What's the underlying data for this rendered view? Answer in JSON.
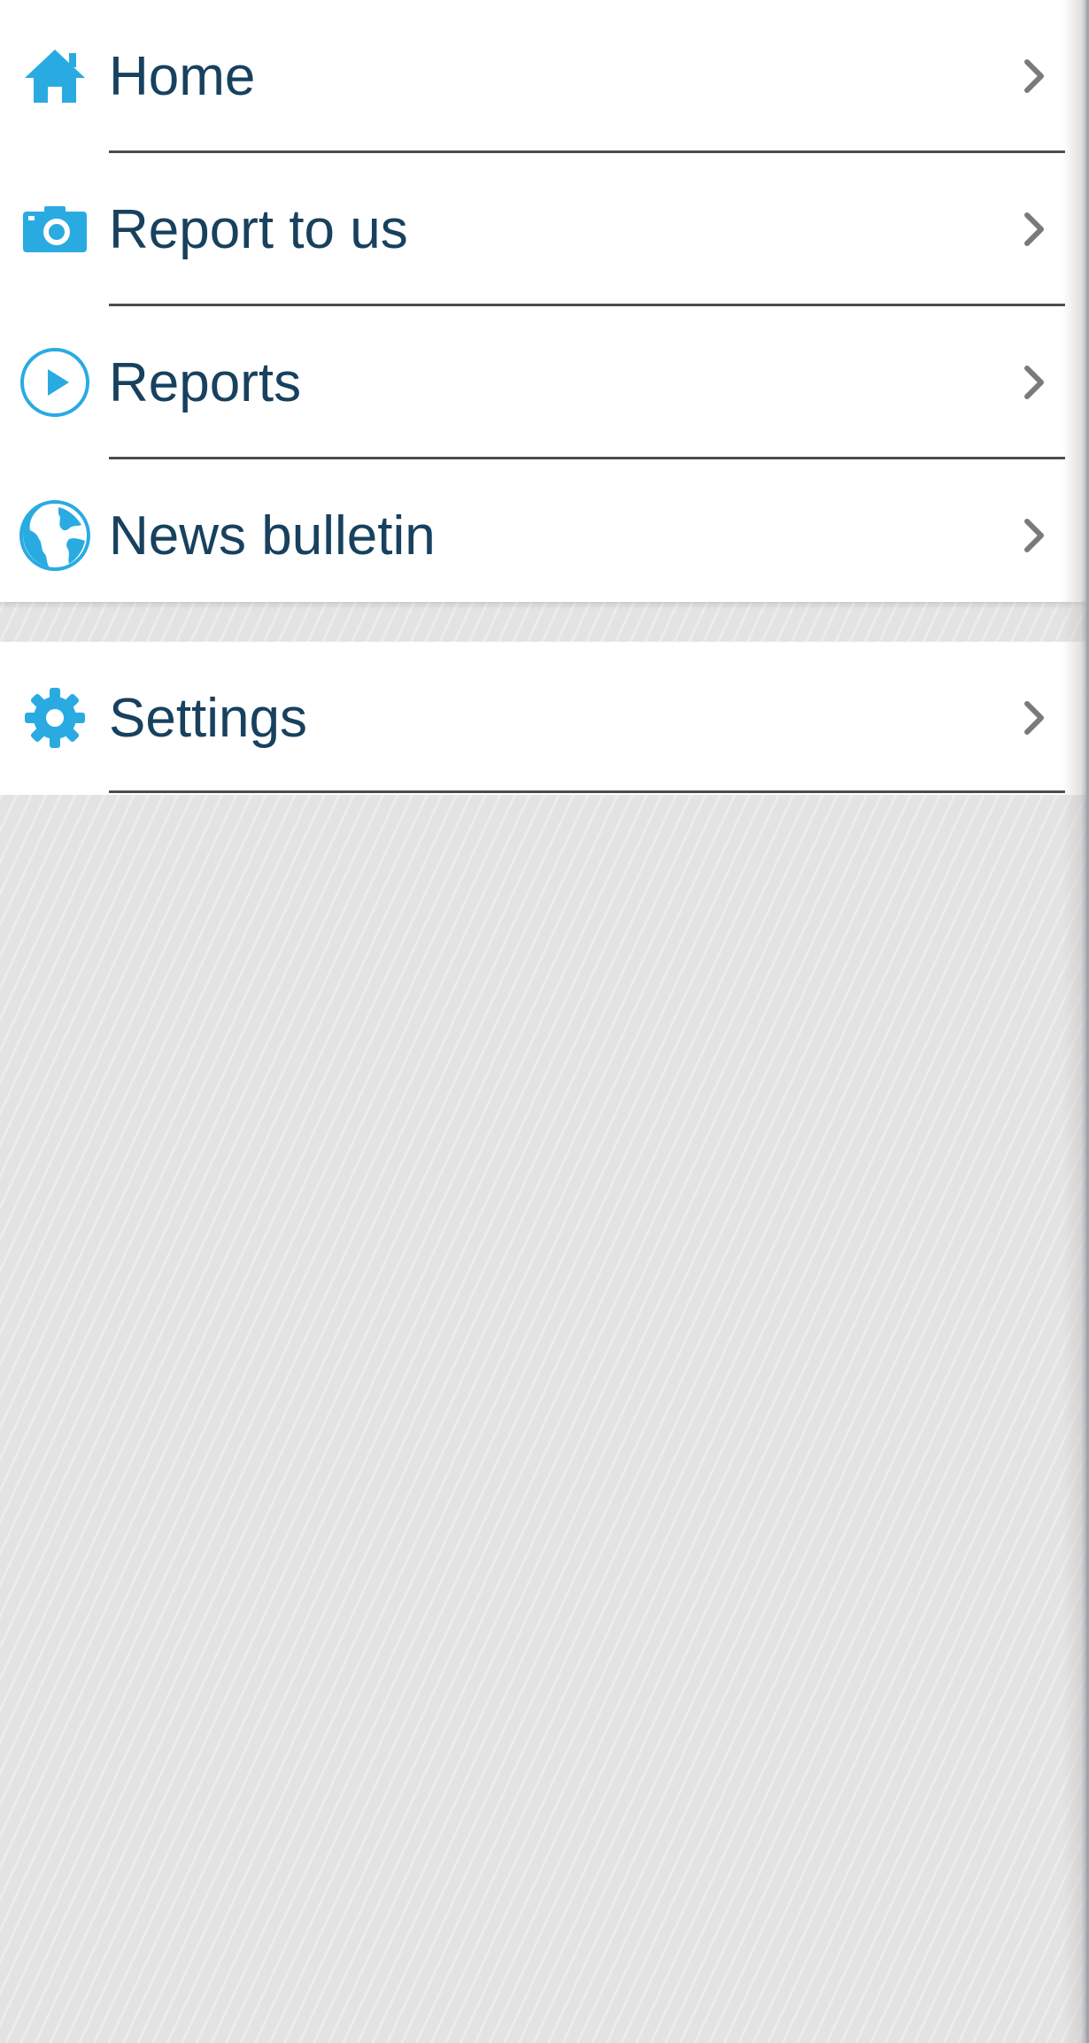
{
  "menu": {
    "items": [
      {
        "label": "Home",
        "icon": "home-icon"
      },
      {
        "label": "Report to us",
        "icon": "camera-icon"
      },
      {
        "label": "Reports",
        "icon": "play-icon"
      },
      {
        "label": "News bulletin",
        "icon": "globe-icon"
      }
    ],
    "settings": {
      "label": "Settings",
      "icon": "gear-icon"
    }
  },
  "colors": {
    "accent": "#29abe2",
    "label": "#17415e",
    "chevron": "#7a7a7a",
    "divider": "#4d4d4d",
    "background": "#e3e3e3"
  }
}
